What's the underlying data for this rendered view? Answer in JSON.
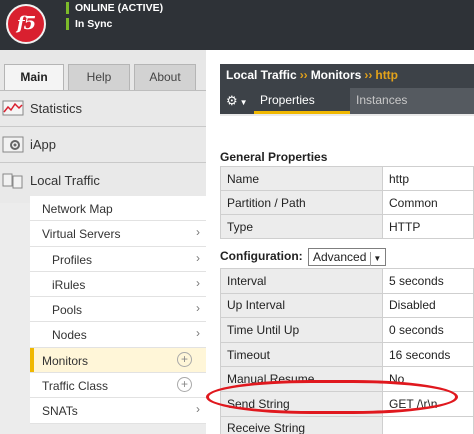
{
  "banner": {
    "logo_text": "f5",
    "status_line1": "ONLINE (ACTIVE)",
    "status_line2": "In Sync",
    "status_color": "#7dbb2a"
  },
  "tabs": [
    {
      "label": "Main",
      "active": true
    },
    {
      "label": "Help",
      "active": false
    },
    {
      "label": "About",
      "active": false
    }
  ],
  "sections": {
    "statistics": "Statistics",
    "iapp": "iApp",
    "local_traffic": "Local Traffic"
  },
  "subnav": [
    {
      "label": "Network Map",
      "control": "none"
    },
    {
      "label": "Virtual Servers",
      "control": "chevron-right-icon"
    },
    {
      "label": "Profiles",
      "control": "chevron-right-icon",
      "indent": true
    },
    {
      "label": "iRules",
      "control": "chevron-right-icon",
      "indent": true
    },
    {
      "label": "Pools",
      "control": "chevron-right-icon",
      "indent": true
    },
    {
      "label": "Nodes",
      "control": "chevron-right-icon",
      "indent": true
    },
    {
      "label": "Monitors",
      "control": "plus-icon",
      "selected": true
    },
    {
      "label": "Traffic Class",
      "control": "plus-icon"
    },
    {
      "label": "SNATs",
      "control": "chevron-right-icon"
    }
  ],
  "breadcrumb": {
    "part1": "Local Traffic",
    "separator": "››",
    "part2": "Monitors",
    "current": "http"
  },
  "toolbar": {
    "gear_symbol": "⚙",
    "tabs": [
      "Properties",
      "Instances"
    ],
    "accent": "#f0b800"
  },
  "general": {
    "title": "General Properties",
    "rows": [
      {
        "key": "Name",
        "value": "http"
      },
      {
        "key": "Partition / Path",
        "value": "Common"
      },
      {
        "key": "Type",
        "value": "HTTP"
      }
    ]
  },
  "configuration": {
    "label": "Configuration:",
    "selected": "Advanced",
    "rows": [
      {
        "key": "Interval",
        "value": "5 seconds"
      },
      {
        "key": "Up Interval",
        "value": "Disabled"
      },
      {
        "key": "Time Until Up",
        "value": "0 seconds"
      },
      {
        "key": "Timeout",
        "value": "16 seconds"
      },
      {
        "key": "Manual Resume",
        "value": "No"
      },
      {
        "key": "Send String",
        "value": "GET /\\r\\n"
      },
      {
        "key": "Receive String",
        "value": ""
      }
    ]
  },
  "annotation_color": "#e0181e"
}
